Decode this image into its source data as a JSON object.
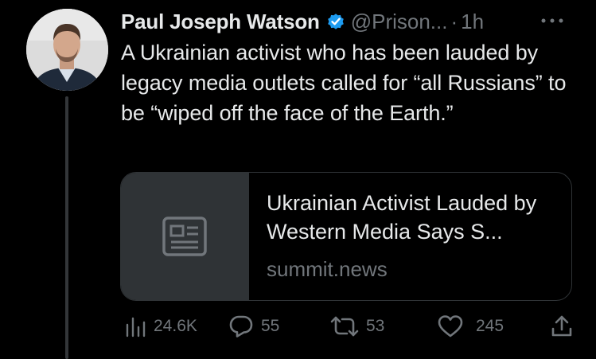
{
  "tweet": {
    "author_name": "Paul Joseph Watson",
    "handle": "@Prison...",
    "separator": "·",
    "time": "1h",
    "text": "A Ukrainian activist who has been lauded by legacy media outlets called for “all Russians” to be “wiped off the face of the Earth.”",
    "card": {
      "title": "Ukrainian Activist Lauded by Western Media Says S...",
      "domain": "summit.news"
    },
    "metrics": {
      "views": "24.6K",
      "replies": "55",
      "retweets": "53",
      "likes": "245"
    }
  },
  "colors": {
    "background": "#000000",
    "text_primary": "#e7e9ea",
    "text_secondary": "#71767b",
    "verified_badge": "#1d9bf0",
    "border": "#2f3336"
  },
  "icons": {
    "verified": "verified-badge-icon",
    "more": "more-dots-icon",
    "card_placeholder": "article-placeholder-icon",
    "views": "views-bar-chart-icon",
    "reply": "reply-bubble-icon",
    "retweet": "retweet-icon",
    "like": "heart-icon",
    "share": "share-icon"
  }
}
